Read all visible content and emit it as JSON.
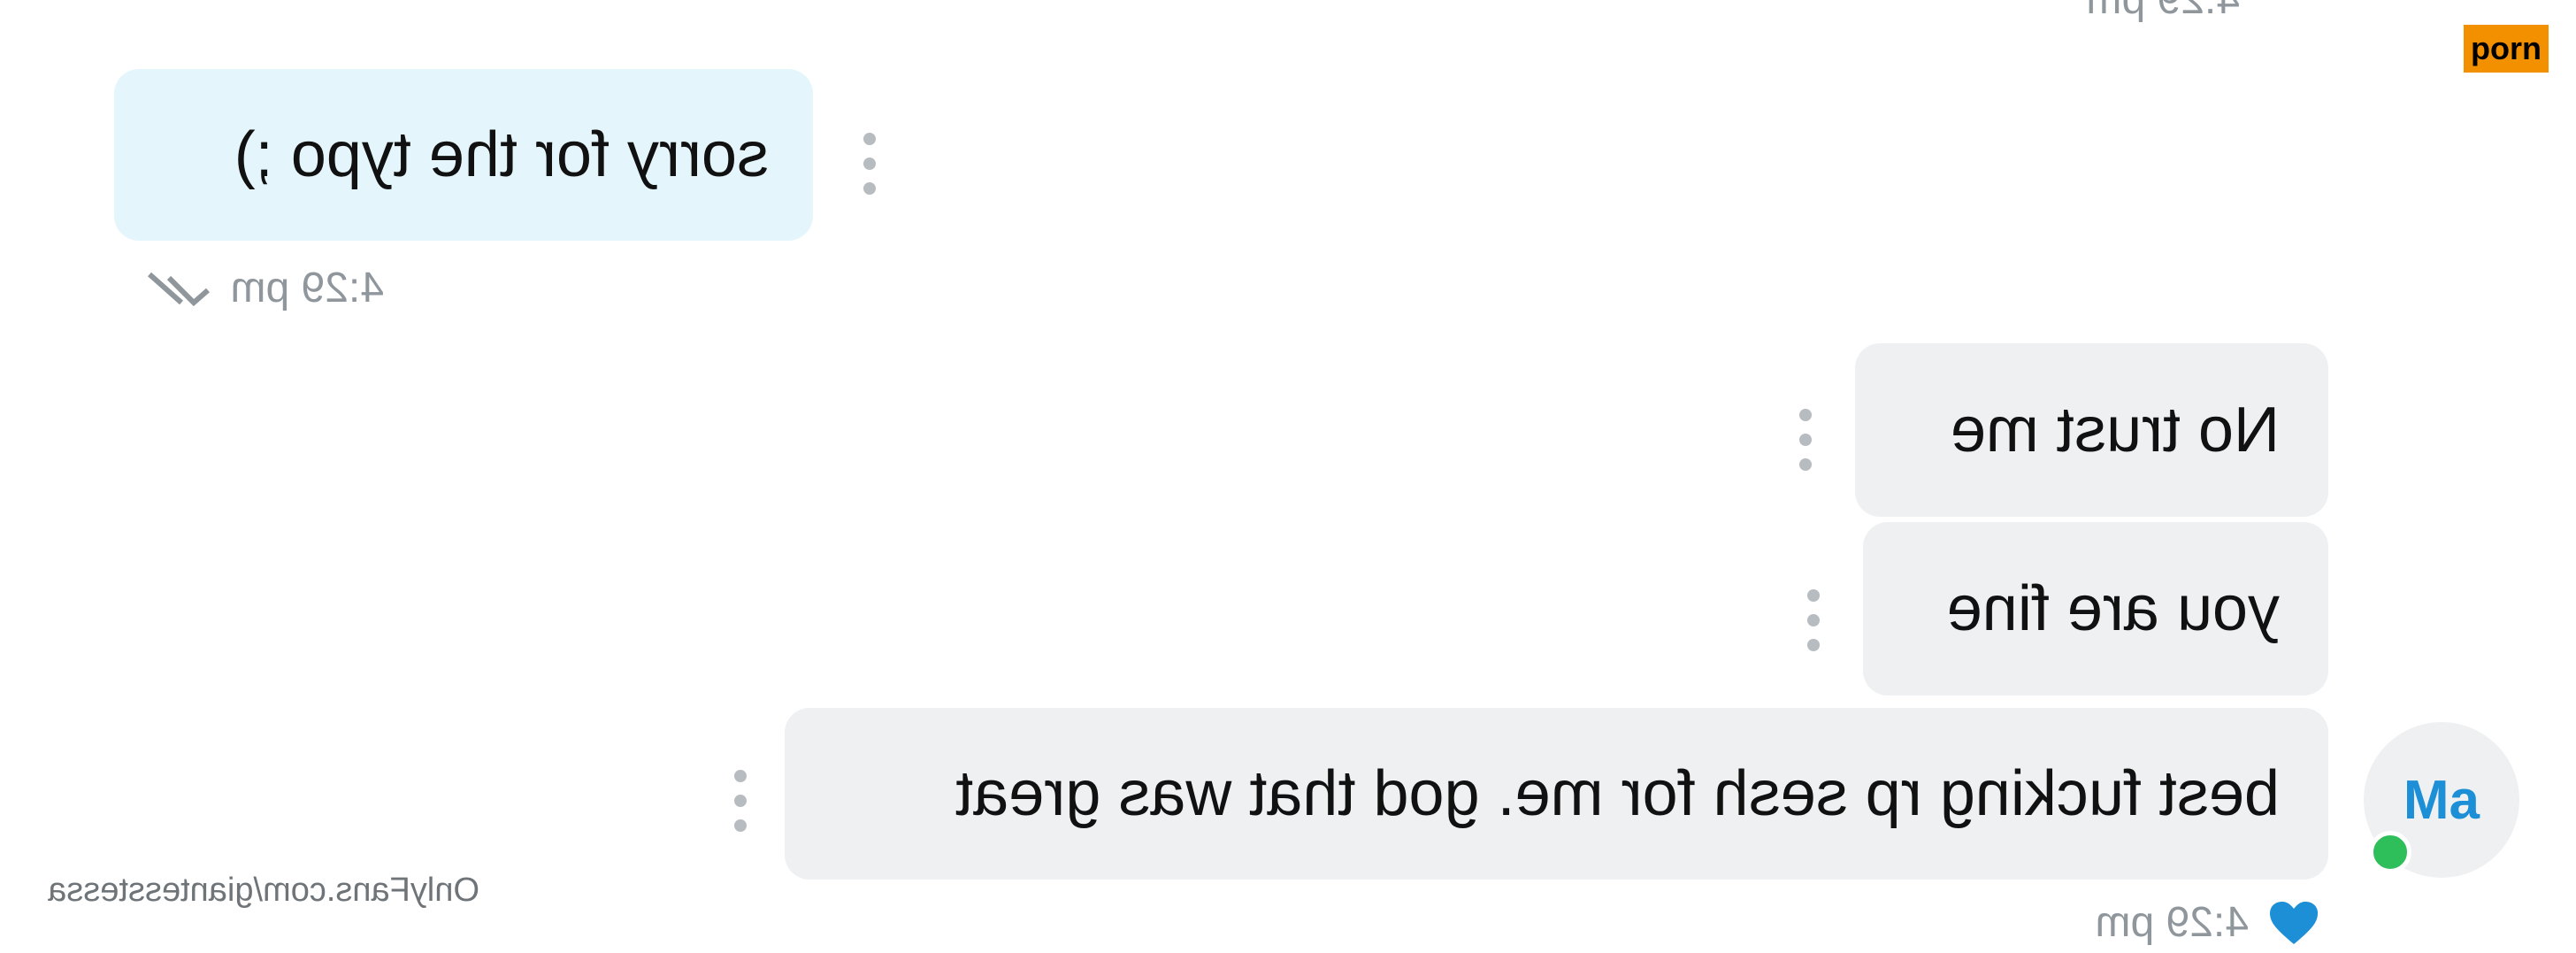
{
  "tag": {
    "label": "porn",
    "color": "#f39000"
  },
  "avatar": {
    "initials": "Ma",
    "color": "#1c8fd6",
    "online": true
  },
  "watermark": "OnlyFans.com/giantesstessa",
  "messages": [
    {
      "text": "best fucking rp sesh for me. god that was great",
      "time": "4:29 pm",
      "liked": true
    },
    {
      "text": "you are fine"
    },
    {
      "text": "No trust me"
    },
    {
      "text": "sorry for the typo ;)",
      "time": "4:29 pm",
      "read": true
    }
  ],
  "top_time": "4:29 pm",
  "icons": [
    "more-vertical-icon",
    "heart-icon",
    "double-check-icon"
  ]
}
